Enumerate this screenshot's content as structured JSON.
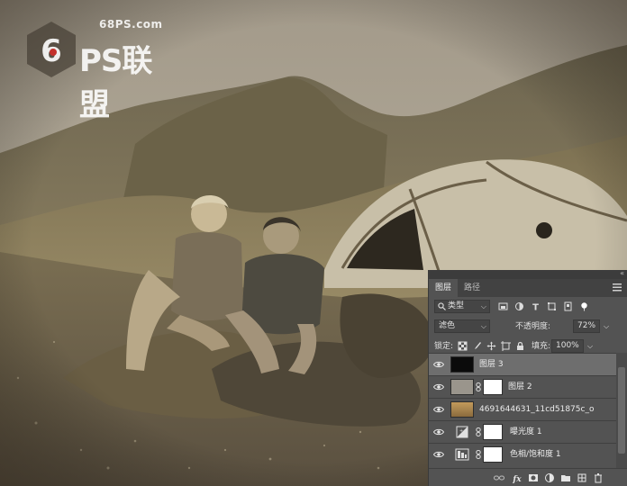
{
  "watermark": {
    "url": "68PS.com",
    "brand": "PS联盟"
  },
  "panel": {
    "tabs": [
      {
        "label": "图层",
        "active": true
      },
      {
        "label": "路径",
        "active": false
      }
    ],
    "filter": {
      "label": "类型",
      "icon": "search-icon"
    },
    "blend_mode": "滤色",
    "opacity_label": "不透明度:",
    "opacity_value": "72%",
    "lock_label": "锁定:",
    "fill_label": "填充:",
    "fill_value": "100%",
    "layers": [
      {
        "name": "图层 3",
        "type": "pixel",
        "selected": true,
        "visible": true
      },
      {
        "name": "图层 2",
        "type": "pixel-with-mask",
        "selected": false,
        "visible": true
      },
      {
        "name": "4691644631_11cd51875c_o",
        "type": "image",
        "selected": false,
        "visible": true
      },
      {
        "name": "曝光度 1",
        "type": "exposure-adjustment",
        "selected": false,
        "visible": true
      },
      {
        "name": "色相/饱和度 1",
        "type": "hue-saturation-adjustment",
        "selected": false,
        "visible": true
      }
    ],
    "bottom_icons": [
      "link-layers-icon",
      "fx-icon",
      "add-mask-icon",
      "adjustment-layer-icon",
      "new-group-icon",
      "new-layer-icon",
      "delete-icon"
    ]
  },
  "colors": {
    "panel_bg": "#535353",
    "selected_layer": "#6e6e6e",
    "photo_tone": "#8c7e64"
  }
}
